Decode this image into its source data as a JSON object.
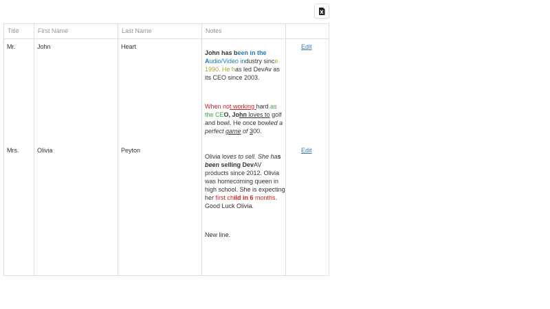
{
  "toolbar": {
    "export_icon": "excel-export-icon",
    "export_glyph": "x"
  },
  "columns": {
    "title": "Title",
    "first_name": "First Name",
    "last_name": "Last Name",
    "notes": "Notes"
  },
  "rows": [
    {
      "title": "Mr.",
      "first_name": "John",
      "last_name": "Heart",
      "edit": "Edit",
      "notes": {
        "p1": [
          "John has b",
          "een in the",
          " A",
          "udio/Video in",
          "dustry sinc",
          "e",
          " 1990. He h",
          "as led DevAv as its CEO since 2003."
        ],
        "p2": [
          "When no",
          "t ",
          "working ",
          "hard ",
          "as",
          " the CE",
          "O, Jo",
          "hn ",
          "loves to",
          " golf and bowl. He once bowl",
          "ed a perfect ",
          "game",
          " of ",
          "3",
          "00."
        ]
      }
    },
    {
      "title": "Mrs.",
      "first_name": "Olivia",
      "last_name": "Peyton",
      "edit": "Edit",
      "notes": {
        "p1": [
          "Olivia lo",
          "ves to sell. She ha",
          "s",
          " been",
          " selling Dev",
          "AV products since 2012. Olivia was homecoming queen in high school. She is expecting her ",
          "first ch",
          "ild in 6 ",
          "months",
          ". Good Luck Olivia."
        ],
        "p2": "New line."
      }
    }
  ],
  "colors": {
    "border": "#dddddd",
    "header_text": "#959595",
    "link": "#337ab7",
    "blue": "#1f7ab8",
    "olive": "#b3a233",
    "green": "#3aa14a",
    "red": "#cc1f1f"
  }
}
